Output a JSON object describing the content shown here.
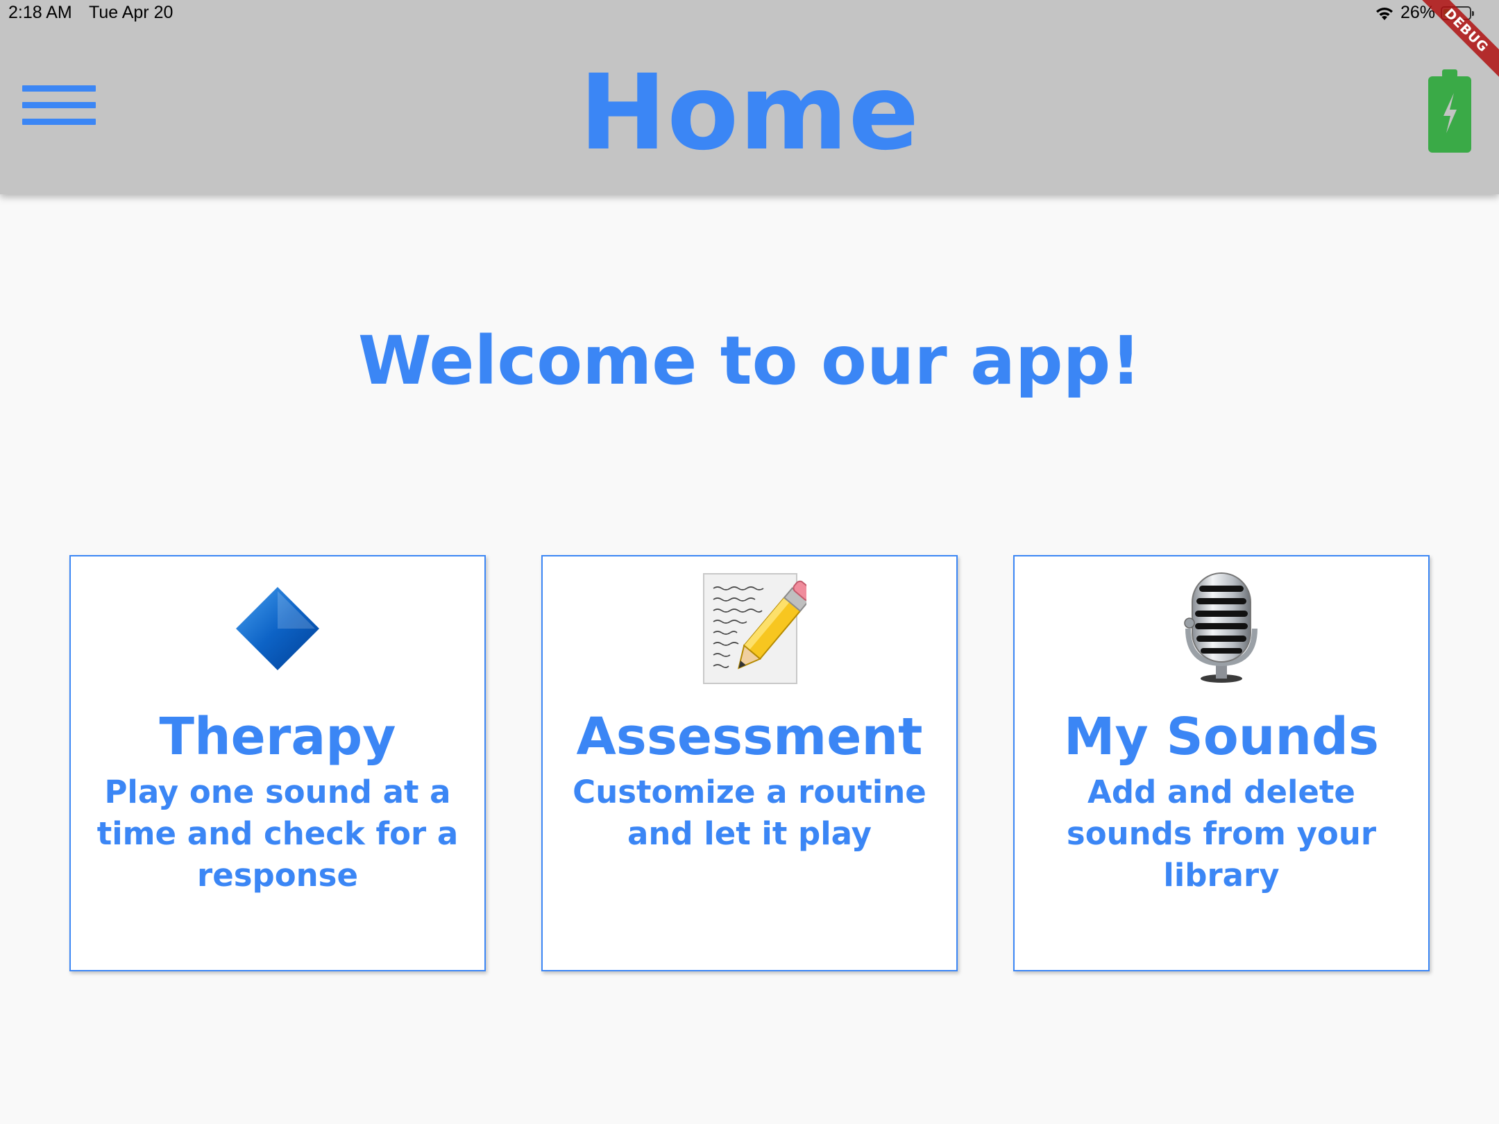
{
  "status_bar": {
    "time": "2:18 AM",
    "date": "Tue Apr 20",
    "battery_percent": "26%"
  },
  "app_bar": {
    "title": "Home",
    "title_color": "#3b86f5",
    "background": "#c4c4c4",
    "menu_icon": "hamburger-menu-icon",
    "action_icon": "battery-charging-icon"
  },
  "debug_banner": "DEBUG",
  "main": {
    "welcome": "Welcome to our app!",
    "cards": [
      {
        "title": "Therapy",
        "description": "Play one sound at a time and check for a response",
        "icon": "blue-diamond-icon"
      },
      {
        "title": "Assessment",
        "description": "Customize a routine and let it play",
        "icon": "memo-pencil-icon"
      },
      {
        "title": "My Sounds",
        "description": "Add and delete sounds from your library",
        "icon": "microphone-icon"
      }
    ]
  }
}
